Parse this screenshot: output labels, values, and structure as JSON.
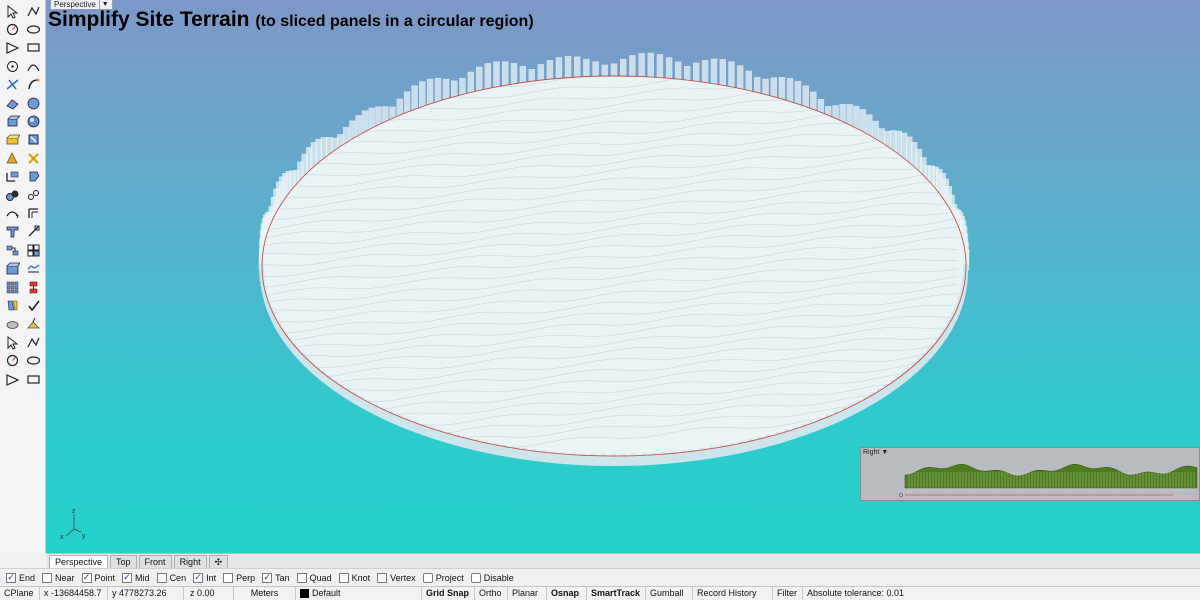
{
  "viewport": {
    "label": "Perspective",
    "overlay_title": "Simplify Site Terrain",
    "overlay_subtitle": "(to sliced panels in a circular region)",
    "axes": {
      "z": "z",
      "x": "x",
      "y": "y"
    }
  },
  "toolbar": {
    "tools": [
      "select-arrow",
      "point",
      "polyline",
      "polyline-2",
      "circle",
      "circle-center",
      "arc",
      "rectangle",
      "ellipse-point",
      "ellipse",
      "polygon",
      "curve",
      "surface-tools",
      "surface-2",
      "box",
      "sphere",
      "extrude",
      "solid-tools",
      "boolean",
      "explode",
      "trim",
      "join",
      "mesh",
      "group",
      "fillet",
      "offset",
      "move",
      "scale",
      "rotate",
      "array",
      "text",
      "dimension",
      "block",
      "layer",
      "render",
      "material",
      "grid",
      "points-on",
      "analyze",
      "check",
      "properties",
      "zebra"
    ]
  },
  "right_viewport": {
    "label": "Right"
  },
  "tabs": [
    "Perspective",
    "Top",
    "Front",
    "Right"
  ],
  "active_tab": "Perspective",
  "osnaps": [
    {
      "label": "End",
      "checked": true
    },
    {
      "label": "Near",
      "checked": false
    },
    {
      "label": "Point",
      "checked": true
    },
    {
      "label": "Mid",
      "checked": true
    },
    {
      "label": "Cen",
      "checked": false
    },
    {
      "label": "Int",
      "checked": true
    },
    {
      "label": "Perp",
      "checked": false
    },
    {
      "label": "Tan",
      "checked": true
    },
    {
      "label": "Quad",
      "checked": false
    },
    {
      "label": "Knot",
      "checked": false
    },
    {
      "label": "Vertex",
      "checked": false
    },
    {
      "label": "Project",
      "checked": false
    },
    {
      "label": "Disable",
      "checked": false
    }
  ],
  "status": {
    "cplane": "CPlane",
    "x": "x -13684458.7",
    "y": "y 4778273.26",
    "z": "z 0.00",
    "units": "Meters",
    "layer": "Default",
    "grid_snap": "Grid Snap",
    "ortho": "Ortho",
    "planar": "Planar",
    "osnap": "Osnap",
    "smarttrack": "SmartTrack",
    "gumball": "Gumball",
    "record_history": "Record History",
    "filter": "Filter",
    "tolerance": "Absolute tolerance: 0.01"
  },
  "colors": {
    "sky_top": "#7c98c8",
    "sky_bottom": "#22d2c8",
    "terrain": "#eaf3f6",
    "boundary_curve": "#c0392b",
    "right_view_terrain": "#4e7d1e"
  }
}
